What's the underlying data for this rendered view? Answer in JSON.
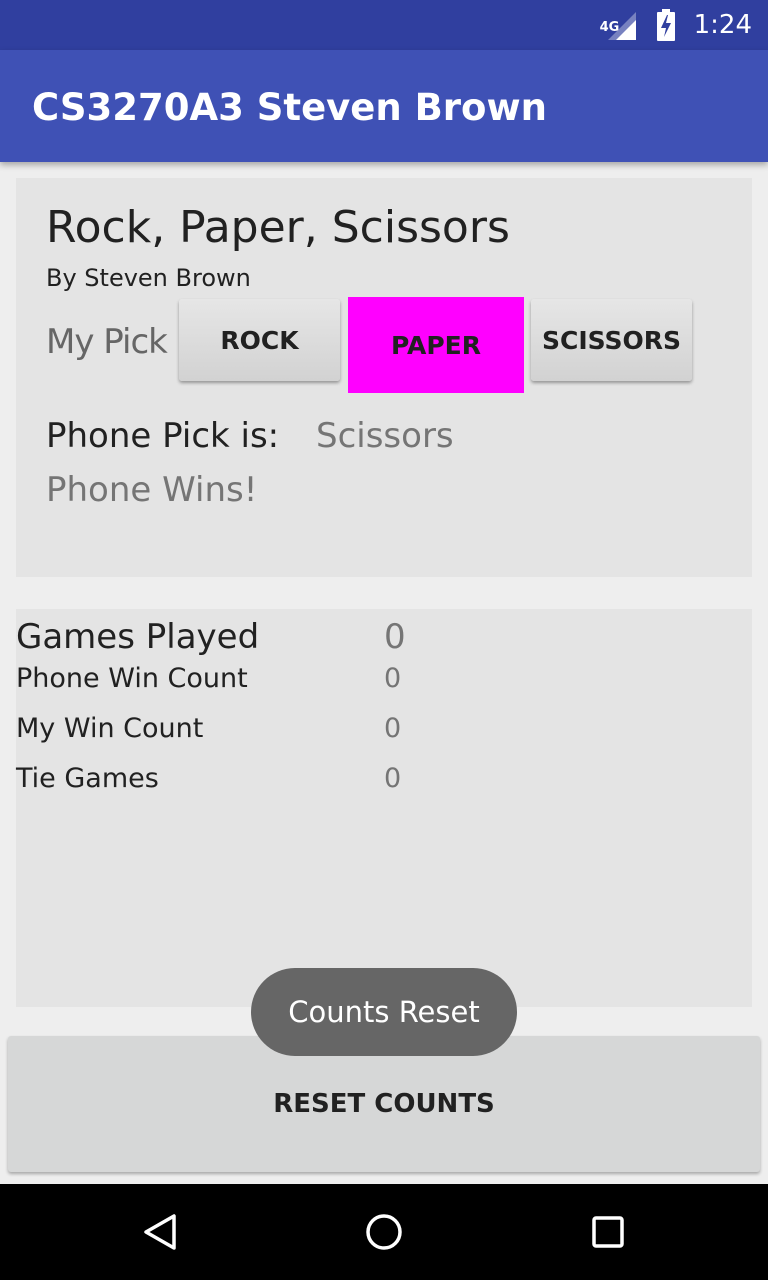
{
  "status_bar": {
    "network": "4G",
    "time": "1:24",
    "icons": [
      "signal-icon",
      "battery-charging-icon"
    ]
  },
  "app_bar": {
    "title": "CS3270A3 Steven Brown"
  },
  "game": {
    "title": "Rock, Paper, Scissors",
    "author": "By Steven Brown",
    "my_pick_label": "My Pick",
    "buttons": {
      "rock": "ROCK",
      "paper": "PAPER",
      "scissors": "SCISSORS"
    },
    "selected_button": "paper",
    "selected_color": "#ff00ff",
    "phone_pick_label": "Phone Pick is:",
    "phone_pick_value": "Scissors",
    "result": "Phone Wins!"
  },
  "stats": {
    "games_played_label": "Games Played",
    "games_played_value": "0",
    "phone_win_label": "Phone Win Count",
    "phone_win_value": "0",
    "my_win_label": "My Win Count",
    "my_win_value": "0",
    "tie_label": "Tie Games",
    "tie_value": "0"
  },
  "reset_button": "RESET COUNTS",
  "toast": "Counts Reset",
  "nav_bar": {
    "icons": [
      "back-icon",
      "home-icon",
      "recent-apps-icon"
    ]
  },
  "colors": {
    "status_bar": "#303f9f",
    "app_bar": "#3f51b5",
    "panel": "#e4e4e4"
  }
}
